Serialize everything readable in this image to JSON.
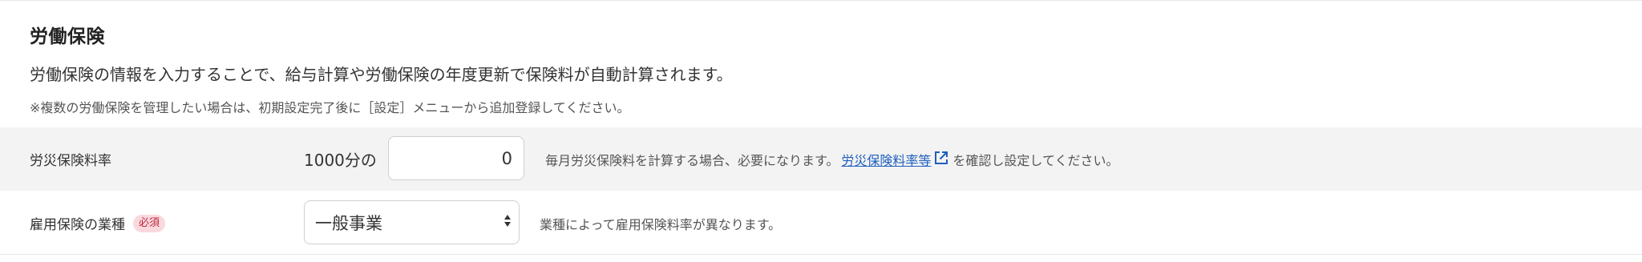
{
  "section": {
    "title": "労働保険",
    "description": "労働保険の情報を入力することで、給与計算や労働保険の年度更新で保険料が自動計算されます。",
    "note": "※複数の労働保険を管理したい場合は、初期設定完了後に［設定］メニューから追加登録してください。"
  },
  "workers_comp_rate": {
    "label": "労災保険料率",
    "prefix": "1000分の",
    "value": "0",
    "help_before": "毎月労災保険料を計算する場合、必要になります。",
    "link_text": "労災保険料率等",
    "help_after": "を確認し設定してください。",
    "link_icon": "external-link-icon"
  },
  "employment_type": {
    "label": "雇用保険の業種",
    "required_badge": "必須",
    "selected": "一般事業",
    "help": "業種によって雇用保険料率が異なります。"
  },
  "colors": {
    "link": "#1f5fbf",
    "badge_bg": "#f9d9dd",
    "badge_text": "#c0263f",
    "row_highlight": "#f3f3f3"
  }
}
